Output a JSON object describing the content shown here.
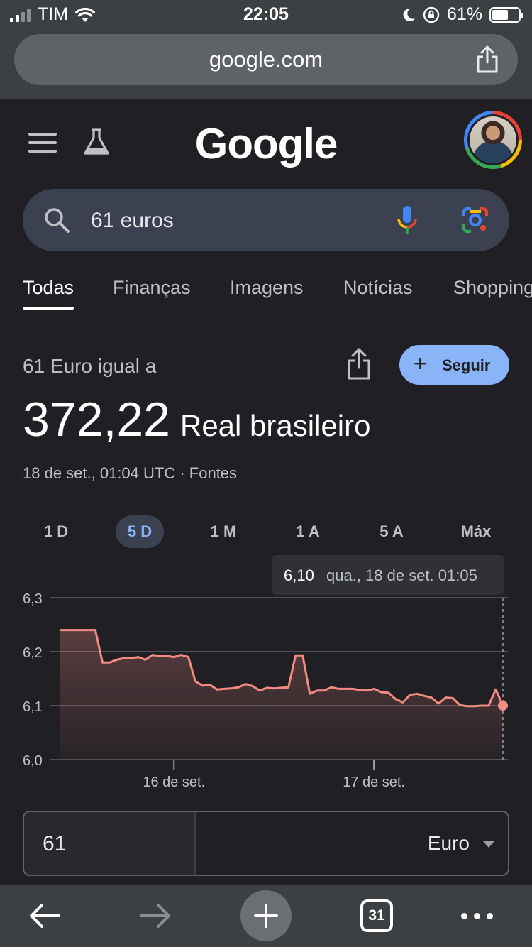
{
  "status_bar": {
    "carrier": "TIM",
    "time": "22:05",
    "battery": "61%",
    "battery_level": 0.61
  },
  "browser": {
    "url": "google.com",
    "tab_count": "31"
  },
  "google": {
    "logo": "Google",
    "search": {
      "query": "61 euros"
    },
    "tabs": [
      "Todas",
      "Finanças",
      "Imagens",
      "Notícias",
      "Shopping"
    ],
    "active_tab": 0
  },
  "conversion": {
    "heading": "61 Euro igual a",
    "follow_label": "Seguir",
    "value": "372,22",
    "currency": "Real brasileiro",
    "timestamp": "18 de set., 01:04 UTC · Fontes",
    "ranges": [
      "1 D",
      "5 D",
      "1 M",
      "1 A",
      "5 A",
      "Máx"
    ],
    "active_range": 1,
    "tooltip": {
      "value": "6,10",
      "date": "qua., 18 de set. 01:05"
    },
    "amount": "61",
    "from_currency": "Euro"
  },
  "colors": {
    "line": "#f28b82",
    "accent": "#8ab4f8",
    "background": "#1f1f24"
  },
  "chart_data": {
    "type": "area",
    "title": "",
    "xlabel": "",
    "ylabel": "",
    "ylim": [
      6.0,
      6.3
    ],
    "yticks": [
      6.0,
      6.1,
      6.2,
      6.3
    ],
    "ytick_labels": [
      "6,0",
      "6,1",
      "6,2",
      "6,3"
    ],
    "xtick_labels": [
      "16 de set.",
      "17 de set."
    ],
    "xtick_positions": [
      0.258,
      0.709
    ],
    "grid": true,
    "series": [
      {
        "values": [
          6.24,
          6.24,
          6.24,
          6.24,
          6.24,
          6.24,
          6.18,
          6.18,
          6.185,
          6.188,
          6.188,
          6.19,
          6.185,
          6.194,
          6.192,
          6.192,
          6.19,
          6.194,
          6.19,
          6.145,
          6.137,
          6.139,
          6.13,
          6.131,
          6.132,
          6.134,
          6.14,
          6.136,
          6.128,
          6.133,
          6.132,
          6.133,
          6.134,
          6.193,
          6.193,
          6.122,
          6.128,
          6.128,
          6.134,
          6.131,
          6.131,
          6.131,
          6.129,
          6.128,
          6.131,
          6.125,
          6.124,
          6.112,
          6.106,
          6.12,
          6.122,
          6.118,
          6.115,
          6.104,
          6.115,
          6.114,
          6.101,
          6.099,
          6.099,
          6.1,
          6.1,
          6.13,
          6.1
        ]
      }
    ],
    "current_value": 6.1
  }
}
